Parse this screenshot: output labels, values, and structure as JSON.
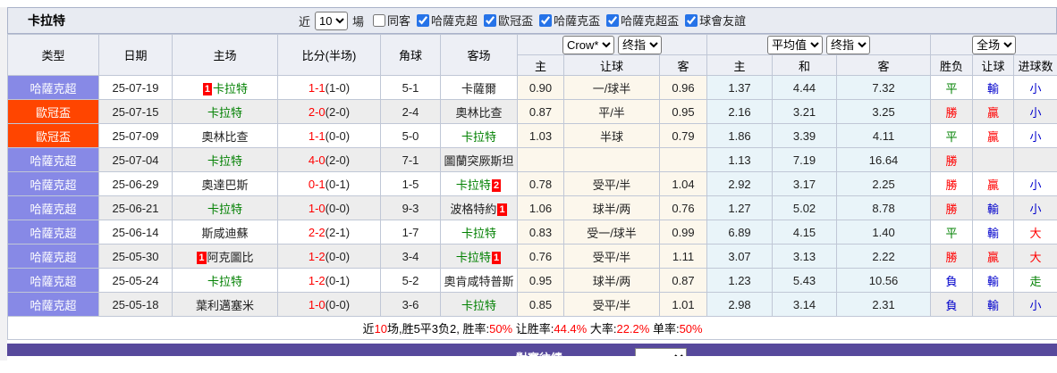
{
  "colors": {
    "type_purple": "#8789e6",
    "type_orange": "#ff4500",
    "text_red": "#ff0000",
    "text_blue": "#0000cc",
    "text_green": "#008000",
    "odds_bg": "#fcf7ec",
    "avg_bg": "#e9f4f9",
    "footer_purple": "#57499c",
    "titlebar_bg": "#e8ebf2"
  },
  "title_bar": {
    "team": "卡拉特",
    "near_label": "近",
    "recent_count": "10",
    "matches_label": "場",
    "checkboxes": [
      {
        "label": "同客",
        "checked": false
      },
      {
        "label": "哈薩克超",
        "checked": true
      },
      {
        "label": "歐冠盃",
        "checked": true
      },
      {
        "label": "哈薩克盃",
        "checked": true
      },
      {
        "label": "哈薩克超盃",
        "checked": true
      },
      {
        "label": "球會友誼",
        "checked": true
      }
    ]
  },
  "table": {
    "headers": {
      "left": [
        "类型",
        "日期",
        "主场",
        "比分(半场)",
        "角球",
        "客场"
      ],
      "sub": [
        "主",
        "让球",
        "客",
        "主",
        "和",
        "客",
        "胜负",
        "让球",
        "进球数"
      ],
      "select_groups": [
        [
          "Crow*",
          "终指"
        ],
        [
          "平均值",
          "终指"
        ],
        [
          "全场"
        ]
      ]
    },
    "rows": [
      {
        "type": "哈薩克超",
        "type_color": "purple",
        "date": "25-07-19",
        "home": {
          "name": "卡拉特",
          "green": true,
          "badge_before": "1"
        },
        "score_ft": "1-1",
        "score_ht": "(1-0)",
        "corner": "5-1",
        "away": {
          "name": "卡薩爾"
        },
        "odds": [
          "0.90",
          "一/球半",
          "0.96"
        ],
        "avg": [
          "1.37",
          "4.44",
          "7.32"
        ],
        "outcome": [
          {
            "text": "平",
            "color": "green"
          },
          {
            "text": "輸",
            "color": "blue"
          },
          {
            "text": "小",
            "color": "blue"
          }
        ]
      },
      {
        "type": "歐冠盃",
        "type_color": "orange",
        "date": "25-07-15",
        "home": {
          "name": "卡拉特",
          "green": true
        },
        "score_ft": "2-0",
        "score_ht": "(2-0)",
        "corner": "2-4",
        "away": {
          "name": "奧林比查"
        },
        "odds": [
          "0.87",
          "平/半",
          "0.95"
        ],
        "avg": [
          "2.16",
          "3.21",
          "3.25"
        ],
        "outcome": [
          {
            "text": "勝",
            "color": "red"
          },
          {
            "text": "贏",
            "color": "red"
          },
          {
            "text": "小",
            "color": "blue"
          }
        ]
      },
      {
        "type": "歐冠盃",
        "type_color": "orange",
        "date": "25-07-09",
        "home": {
          "name": "奧林比查"
        },
        "score_ft": "1-1",
        "score_ht": "(0-0)",
        "corner": "5-0",
        "away": {
          "name": "卡拉特",
          "green": true
        },
        "odds": [
          "1.03",
          "半球",
          "0.79"
        ],
        "avg": [
          "1.86",
          "3.39",
          "4.11"
        ],
        "outcome": [
          {
            "text": "平",
            "color": "green"
          },
          {
            "text": "贏",
            "color": "red"
          },
          {
            "text": "小",
            "color": "blue"
          }
        ]
      },
      {
        "type": "哈薩克超",
        "type_color": "purple",
        "date": "25-07-04",
        "home": {
          "name": "卡拉特",
          "green": true
        },
        "score_ft": "4-0",
        "score_ht": "(2-0)",
        "corner": "7-1",
        "away": {
          "name": "圖蘭突厥斯坦"
        },
        "odds": [
          "",
          "",
          ""
        ],
        "avg": [
          "1.13",
          "7.19",
          "16.64"
        ],
        "outcome": [
          {
            "text": "勝",
            "color": "red"
          },
          {
            "text": "",
            "color": ""
          },
          {
            "text": "",
            "color": ""
          }
        ]
      },
      {
        "type": "哈薩克超",
        "type_color": "purple",
        "date": "25-06-29",
        "home": {
          "name": "奧達巴斯"
        },
        "score_ft": "0-1",
        "score_ht": "(0-1)",
        "corner": "1-5",
        "away": {
          "name": "卡拉特",
          "green": true,
          "badge_after": "2"
        },
        "odds": [
          "0.78",
          "受平/半",
          "1.04"
        ],
        "avg": [
          "2.92",
          "3.17",
          "2.25"
        ],
        "outcome": [
          {
            "text": "勝",
            "color": "red"
          },
          {
            "text": "贏",
            "color": "red"
          },
          {
            "text": "小",
            "color": "blue"
          }
        ]
      },
      {
        "type": "哈薩克超",
        "type_color": "purple",
        "date": "25-06-21",
        "home": {
          "name": "卡拉特",
          "green": true
        },
        "score_ft": "1-0",
        "score_ht": "(0-0)",
        "corner": "9-3",
        "away": {
          "name": "波格特約",
          "badge_after": "1"
        },
        "odds": [
          "1.06",
          "球半/两",
          "0.76"
        ],
        "avg": [
          "1.27",
          "5.02",
          "8.78"
        ],
        "outcome": [
          {
            "text": "勝",
            "color": "red"
          },
          {
            "text": "輸",
            "color": "blue"
          },
          {
            "text": "小",
            "color": "blue"
          }
        ]
      },
      {
        "type": "哈薩克超",
        "type_color": "purple",
        "date": "25-06-14",
        "home": {
          "name": "斯咸迪蘇"
        },
        "score_ft": "2-2",
        "score_ht": "(2-1)",
        "corner": "1-7",
        "away": {
          "name": "卡拉特",
          "green": true
        },
        "odds": [
          "0.83",
          "受一/球半",
          "0.99"
        ],
        "avg": [
          "6.89",
          "4.15",
          "1.40"
        ],
        "outcome": [
          {
            "text": "平",
            "color": "green"
          },
          {
            "text": "輸",
            "color": "blue"
          },
          {
            "text": "大",
            "color": "red"
          }
        ]
      },
      {
        "type": "哈薩克超",
        "type_color": "purple",
        "date": "25-05-30",
        "home": {
          "name": "阿克圖比",
          "badge_before": "1"
        },
        "score_ft": "1-2",
        "score_ht": "(0-0)",
        "corner": "3-4",
        "away": {
          "name": "卡拉特",
          "green": true,
          "badge_after": "1"
        },
        "odds": [
          "0.76",
          "受平/半",
          "1.11"
        ],
        "avg": [
          "3.07",
          "3.13",
          "2.22"
        ],
        "outcome": [
          {
            "text": "勝",
            "color": "red"
          },
          {
            "text": "贏",
            "color": "red"
          },
          {
            "text": "大",
            "color": "red"
          }
        ]
      },
      {
        "type": "哈薩克超",
        "type_color": "purple",
        "date": "25-05-24",
        "home": {
          "name": "卡拉特",
          "green": true
        },
        "score_ft": "1-2",
        "score_ht": "(0-1)",
        "corner": "5-2",
        "away": {
          "name": "奧肯咸特普斯"
        },
        "odds": [
          "0.95",
          "球半/两",
          "0.87"
        ],
        "avg": [
          "1.23",
          "5.43",
          "10.56"
        ],
        "outcome": [
          {
            "text": "負",
            "color": "blue"
          },
          {
            "text": "輸",
            "color": "blue"
          },
          {
            "text": "走",
            "color": "green"
          }
        ]
      },
      {
        "type": "哈薩克超",
        "type_color": "purple",
        "date": "25-05-18",
        "home": {
          "name": "葉利邁塞米"
        },
        "score_ft": "1-0",
        "score_ht": "(0-0)",
        "corner": "3-6",
        "away": {
          "name": "卡拉特",
          "green": true
        },
        "odds": [
          "0.85",
          "受平/半",
          "1.01"
        ],
        "avg": [
          "2.98",
          "3.14",
          "2.31"
        ],
        "outcome": [
          {
            "text": "負",
            "color": "blue"
          },
          {
            "text": "輸",
            "color": "blue"
          },
          {
            "text": "小",
            "color": "blue"
          }
        ]
      }
    ]
  },
  "summary": {
    "segments": [
      {
        "text": "近"
      },
      {
        "text": "10",
        "red": true
      },
      {
        "text": "场,胜5平3负2, 胜率:"
      },
      {
        "text": "50%",
        "red": true
      },
      {
        "text": " 让胜率:"
      },
      {
        "text": "44.4%",
        "red": true
      },
      {
        "text": " 大率:"
      },
      {
        "text": "22.2%",
        "red": true
      },
      {
        "text": " 单率:"
      },
      {
        "text": "50%",
        "red": true
      }
    ]
  },
  "footer": {
    "label": "對賽往績:"
  }
}
